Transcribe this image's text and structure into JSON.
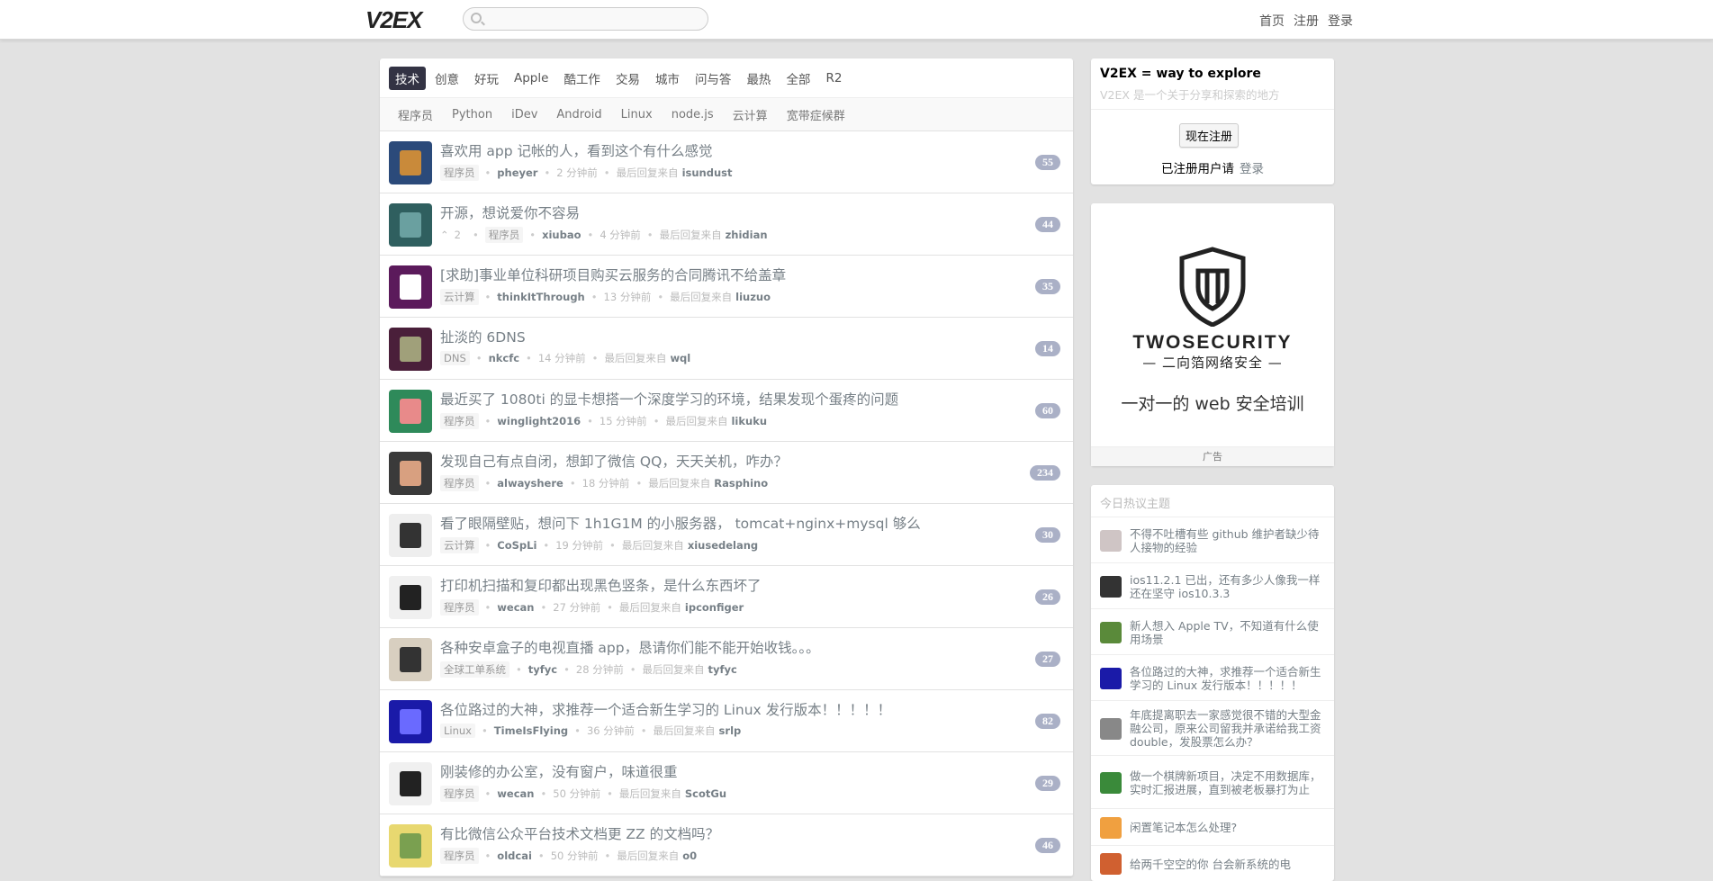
{
  "header": {
    "logo": "V2EX",
    "search": {
      "value": "",
      "placeholder": ""
    },
    "nav": [
      "首页",
      "注册",
      "登录"
    ]
  },
  "tabs": [
    "技术",
    "创意",
    "好玩",
    "Apple",
    "酷工作",
    "交易",
    "城市",
    "问与答",
    "最热",
    "全部",
    "R2"
  ],
  "active_tab": "技术",
  "subtabs": [
    "程序员",
    "Python",
    "iDev",
    "Android",
    "Linux",
    "node.js",
    "云计算",
    "宽带症候群"
  ],
  "topics": [
    {
      "title": "喜欢用 app 记帐的人，看到这个有什么感觉",
      "votes": "",
      "node": "程序员",
      "author": "pheyer",
      "time": "2 分钟前",
      "last_label": "最后回复来自",
      "last_reply": "isundust",
      "count": "55"
    },
    {
      "title": "开源，想说爱你不容易",
      "votes": "2",
      "node": "程序员",
      "author": "xiubao",
      "time": "4 分钟前",
      "last_label": "最后回复来自",
      "last_reply": "zhidian",
      "count": "44"
    },
    {
      "title": "[求助]事业单位科研项目购买云服务的合同腾讯不给盖章",
      "votes": "",
      "node": "云计算",
      "author": "thinkItThrough",
      "time": "13 分钟前",
      "last_label": "最后回复来自",
      "last_reply": "liuzuo",
      "count": "35"
    },
    {
      "title": "扯淡的 6DNS",
      "votes": "",
      "node": "DNS",
      "author": "nkcfc",
      "time": "14 分钟前",
      "last_label": "最后回复来自",
      "last_reply": "wql",
      "count": "14"
    },
    {
      "title": "最近买了 1080ti 的显卡想搭一个深度学习的环境，结果发现个蛋疼的问题",
      "votes": "",
      "node": "程序员",
      "author": "winglight2016",
      "time": "15 分钟前",
      "last_label": "最后回复来自",
      "last_reply": "likuku",
      "count": "60"
    },
    {
      "title": "发现自己有点自闭，想卸了微信 QQ，天天关机，咋办？",
      "votes": "",
      "node": "程序员",
      "author": "alwayshere",
      "time": "18 分钟前",
      "last_label": "最后回复来自",
      "last_reply": "Rasphino",
      "count": "234"
    },
    {
      "title": "看了眼隔壁贴，想问下 1h1G1M 的小服务器， tomcat+nginx+mysql 够么",
      "votes": "",
      "node": "云计算",
      "author": "CoSpLi",
      "time": "19 分钟前",
      "last_label": "最后回复来自",
      "last_reply": "xiusedelang",
      "count": "30"
    },
    {
      "title": "打印机扫描和复印都出现黑色竖条，是什么东西坏了",
      "votes": "",
      "node": "程序员",
      "author": "wecan",
      "time": "27 分钟前",
      "last_label": "最后回复来自",
      "last_reply": "ipconfiger",
      "count": "26"
    },
    {
      "title": "各种安卓盒子的电视直播 app，恳请你们能不能开始收钱。。。",
      "votes": "",
      "node": "全球工单系统",
      "author": "tyfyc",
      "time": "28 分钟前",
      "last_label": "最后回复来自",
      "last_reply": "tyfyc",
      "count": "27"
    },
    {
      "title": "各位路过的大神，求推荐一个适合新生学习的 Linux 发行版本！！！！！",
      "votes": "",
      "node": "Linux",
      "author": "TimeIsFlying",
      "time": "36 分钟前",
      "last_label": "最后回复来自",
      "last_reply": "srlp",
      "count": "82"
    },
    {
      "title": "刚装修的办公室，没有窗户，味道很重",
      "votes": "",
      "node": "程序员",
      "author": "wecan",
      "time": "50 分钟前",
      "last_label": "最后回复来自",
      "last_reply": "ScotGu",
      "count": "29"
    },
    {
      "title": "有比微信公众平台技术文档更 ZZ 的文档吗？",
      "votes": "",
      "node": "程序员",
      "author": "oldcai",
      "time": "50 分钟前",
      "last_label": "最后回复来自",
      "last_reply": "o0",
      "count": "46"
    }
  ],
  "sidebar": {
    "intro_title": "V2EX = way to explore",
    "intro_sub": "V2EX 是一个关于分享和探索的地方",
    "signup_label": "现在注册",
    "login_prefix": "已注册用户请",
    "login_label": "登录",
    "ad": {
      "brand": "TWOSECURITY",
      "brand_cn": "— 二向箔网络安全 —",
      "tagline": "一对一的 web 安全培训",
      "label": "广告"
    },
    "hot_title": "今日热议主题",
    "hot": [
      "不得不吐槽有些 github 维护者缺少待人接物的经验",
      "ios11.2.1 已出，还有多少人像我一样还在坚守 ios10.3.3",
      "新人想入 Apple TV，不知道有什么使用场景",
      "各位路过的大神，求推荐一个适合新生学习的 Linux 发行版本！！！！！",
      "年底提离职去一家感觉很不错的大型金融公司，原来公司留我并承诺给我工资 double，发股票怎么办？",
      "做一个棋牌新项目，决定不用数据库，实时汇报进展，直到被老板暴打为止",
      "闲置笔记本怎么处理?",
      "给两千空空的你 台会新系统的电"
    ]
  },
  "colors": {
    "accent": "#334455",
    "count_badge": "#aab0c6",
    "link": "#778087",
    "background": "#e2e2e2"
  }
}
